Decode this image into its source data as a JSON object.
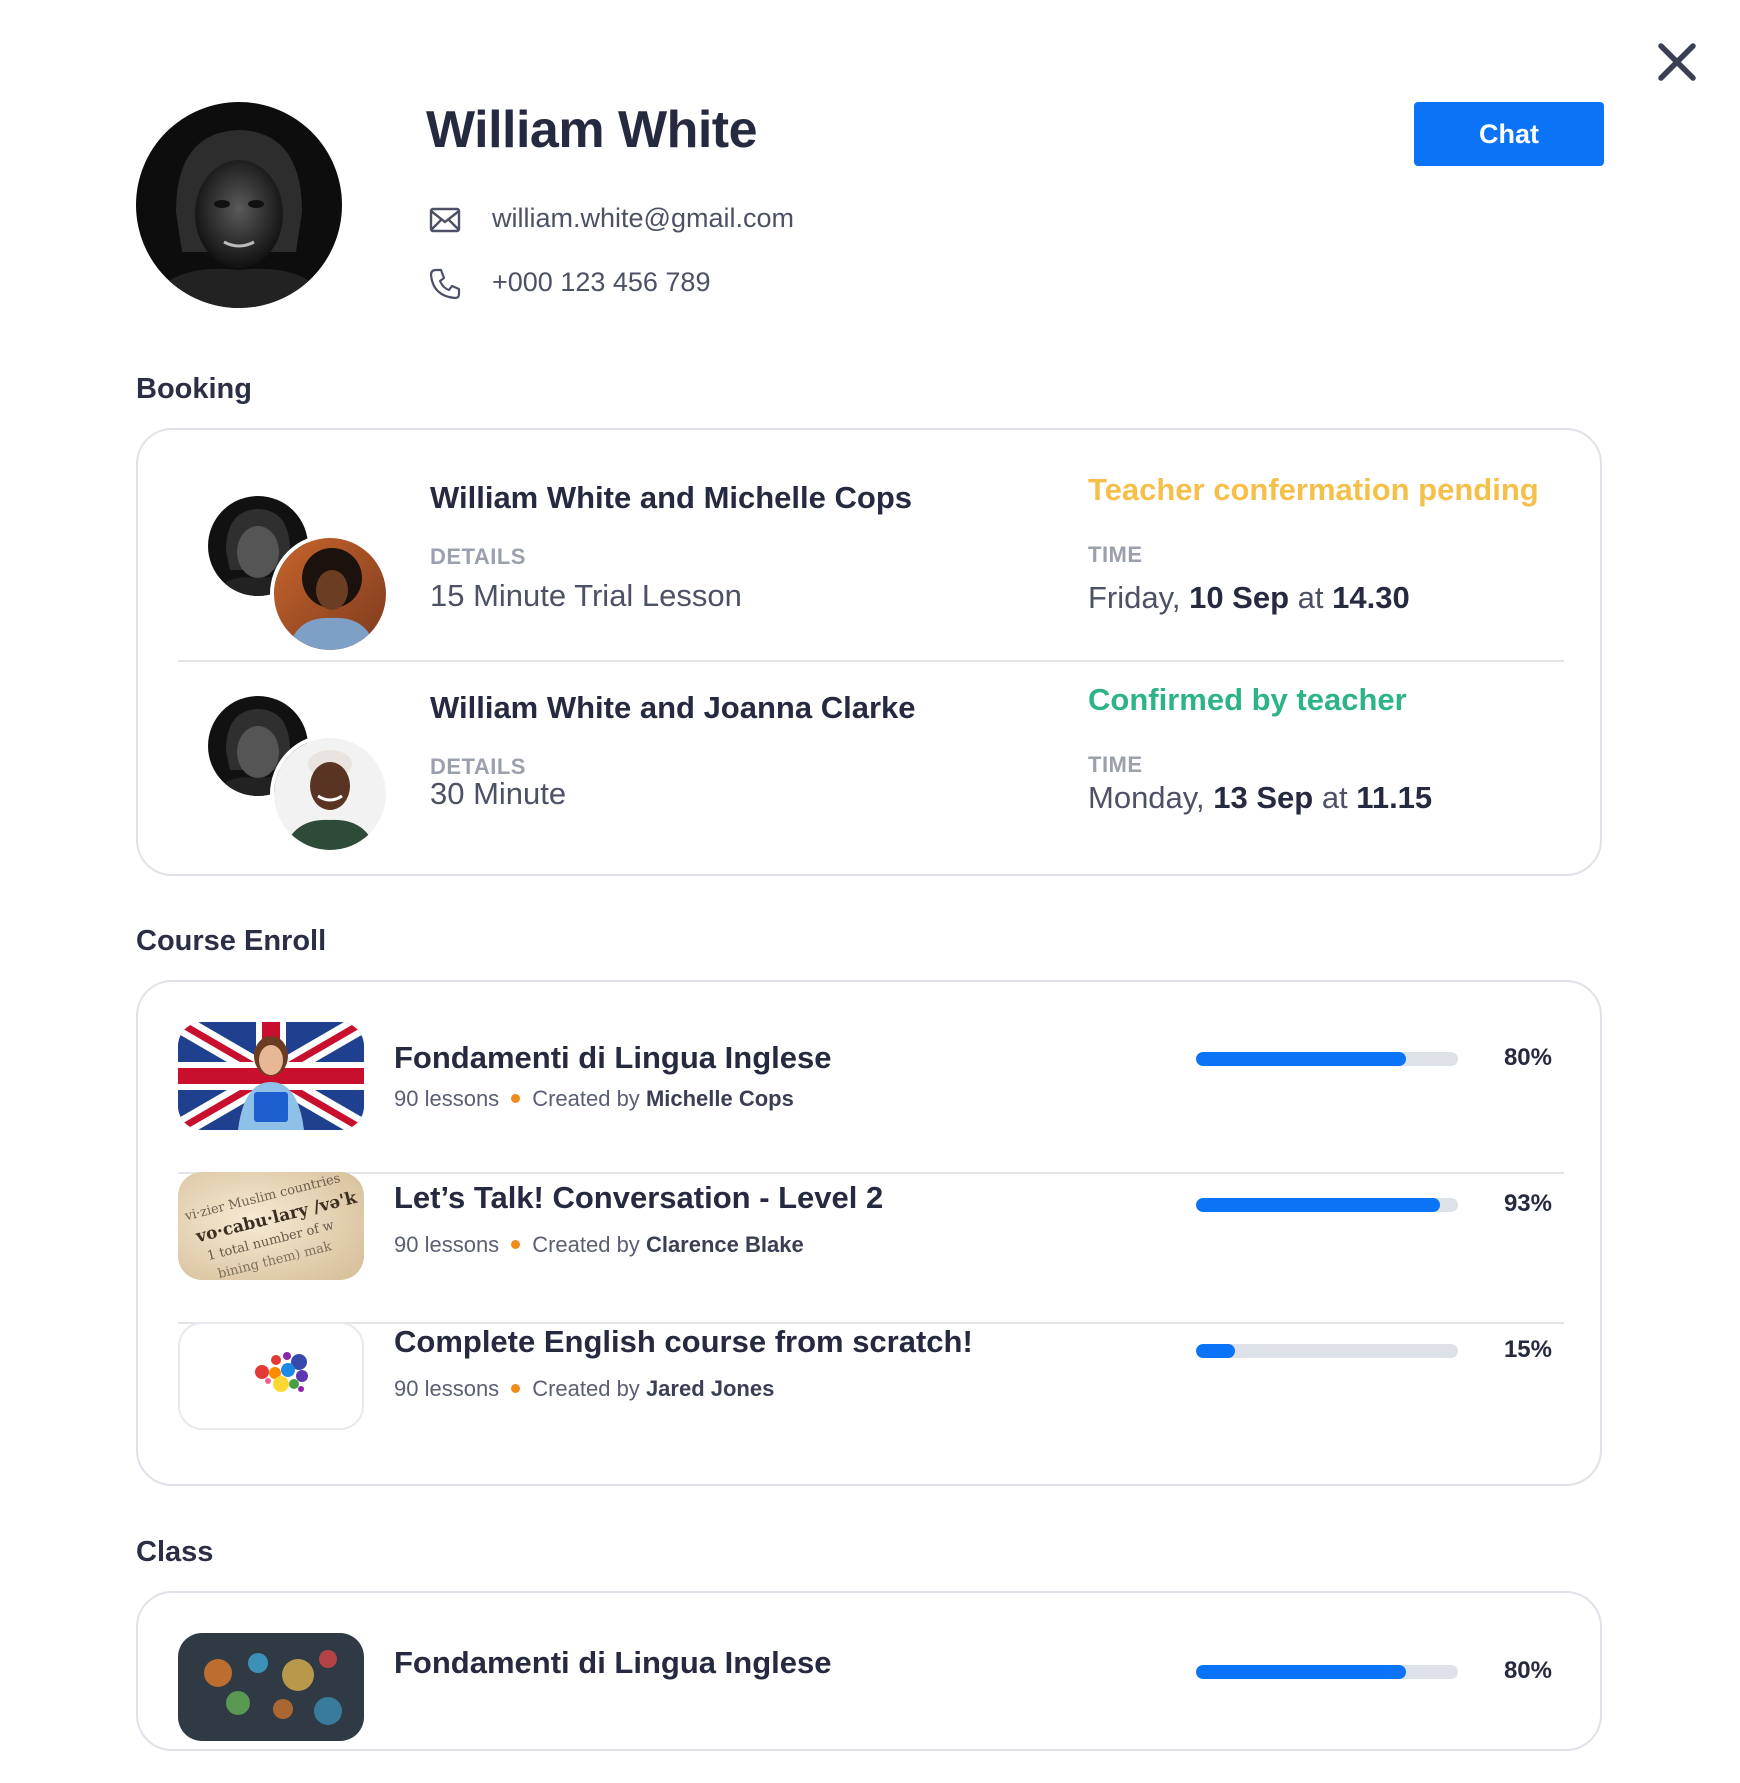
{
  "profile": {
    "name": "William White",
    "email": "william.white@gmail.com",
    "phone": "+000 123 456 789",
    "chat_label": "Chat"
  },
  "sections": {
    "booking": "Booking",
    "course": "Course Enroll",
    "class": "Class"
  },
  "bookings": [
    {
      "title": "William White and Michelle Cops",
      "status": "Teacher confermation pending",
      "status_color": "#f5c04a",
      "details_label": "DETAILS",
      "details": "15 Minute Trial Lesson",
      "time_label": "TIME",
      "day": "Friday,",
      "date": "10 Sep",
      "at": "at",
      "time": "14.30"
    },
    {
      "title": "William White and Joanna Clarke",
      "status": "Confirmed by teacher",
      "status_color": "#2db38a",
      "details_label": "DETAILS",
      "details": "30 Minute",
      "time_label": "TIME",
      "day": "Monday,",
      "date": "13 Sep",
      "at": "at",
      "time": "11.15"
    }
  ],
  "courses": [
    {
      "title": "Fondamenti di Lingua Inglese",
      "lessons": "90 lessons",
      "created_by": "Created by",
      "author": "Michelle Cops",
      "progress": 80,
      "progress_label": "80%"
    },
    {
      "title": "Let’s Talk! Conversation - Level 2",
      "lessons": "90 lessons",
      "created_by": "Created by",
      "author": "Clarence Blake",
      "progress": 93,
      "progress_label": "93%"
    },
    {
      "title": "Complete English course from scratch!",
      "lessons": "90 lessons",
      "created_by": "Created by",
      "author": "Jared Jones",
      "progress": 15,
      "progress_label": "15%"
    }
  ],
  "classes": [
    {
      "title": "Fondamenti di Lingua Inglese",
      "progress": 80,
      "progress_label": "80%"
    }
  ],
  "colors": {
    "accent": "#0b73f6",
    "pending": "#f5c04a",
    "confirmed": "#2db38a",
    "meta_dot": "#f08a1c"
  },
  "icons": [
    "close-icon",
    "mail-icon",
    "phone-icon"
  ]
}
